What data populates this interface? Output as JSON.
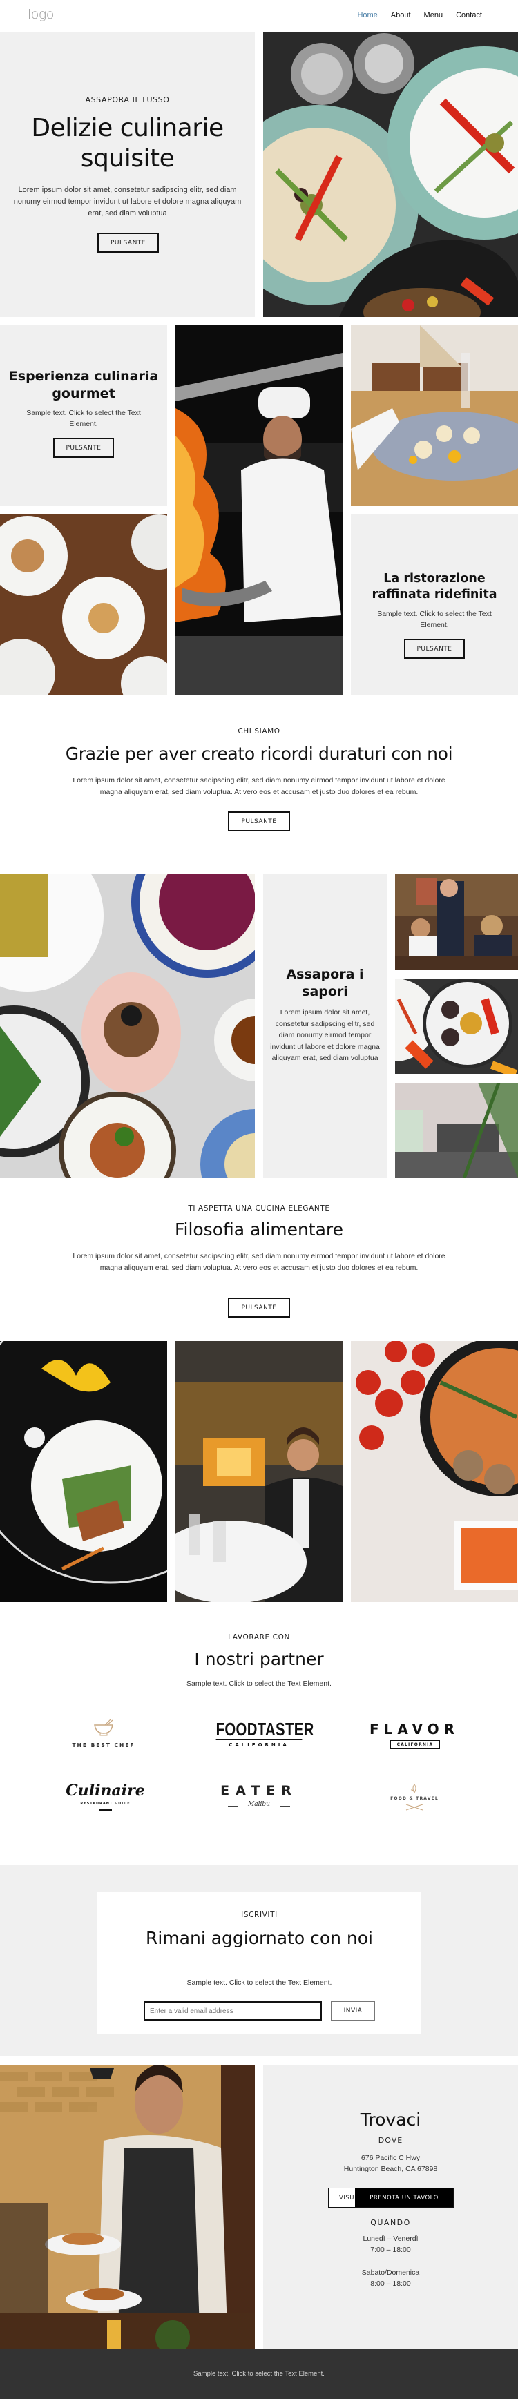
{
  "header": {
    "logo": "logo",
    "nav": [
      {
        "label": "Home",
        "active": true
      },
      {
        "label": "About",
        "active": false
      },
      {
        "label": "Menu",
        "active": false
      },
      {
        "label": "Contact",
        "active": false
      }
    ]
  },
  "hero": {
    "eyebrow": "ASSAPORA IL LUSSO",
    "title": "Delizie culinarie squisite",
    "text": "Lorem ipsum dolor sit amet, consetetur sadipscing elitr, sed diam nonumy eirmod tempor invidunt ut labore et dolore magna aliquyam erat, sed diam voluptua",
    "button": "PULSANTE",
    "image": "mezze-plates-photo"
  },
  "grid": {
    "card1": {
      "title": "Esperienza culinaria gourmet",
      "text": "Sample text. Click to select the Text Element.",
      "button": "PULSANTE"
    },
    "card2": {
      "title": "La ristorazione raffinata ridefinita",
      "text": "Sample text. Click to select the Text Element.",
      "button": "PULSANTE"
    },
    "images": [
      "chef-flambe-photo",
      "scallops-plate-photo",
      "table-dishes-photo"
    ]
  },
  "about": {
    "eyebrow": "CHI SIAMO",
    "title": "Grazie per aver creato ricordi duraturi con noi",
    "text": "Lorem ipsum dolor sit amet, consetetur sadipscing elitr, sed diam nonumy eirmod tempor invidunt ut labore et dolore magna aliquyam erat, sed diam voluptua. At vero eos et accusam et justo duo dolores et ea rebum.",
    "button": "PULSANTE"
  },
  "mosaic": {
    "title": "Assapora i sapori",
    "text": "Lorem ipsum dolor sit amet, consetetur sadipscing elitr, sed diam nonumy eirmod tempor invidunt ut labore et dolore magna aliquyam erat, sed diam voluptua",
    "images": [
      "plated-dishes-marble-photo",
      "friends-dining-photo",
      "vegetables-plate-photo",
      "restaurant-interior-photo"
    ]
  },
  "philosophy": {
    "eyebrow": "TI ASPETTA UNA CUCINA ELEGANTE",
    "title": "Filosofia alimentare",
    "text": "Lorem ipsum dolor sit amet, consetetur sadipscing elitr, sed diam nonumy eirmod tempor invidunt ut labore et dolore magna aliquyam erat, sed diam voluptua. At vero eos et accusam et justo duo dolores et ea rebum.",
    "button": "PULSANTE",
    "images": [
      "duck-salad-plate-photo",
      "man-dining-photo",
      "tomato-meatballs-photo"
    ]
  },
  "partners": {
    "eyebrow": "LAVORARE CON",
    "title": "I nostri partner",
    "text": "Sample text. Click to select the Text Element.",
    "logos": [
      {
        "name": "THE BEST CHEF"
      },
      {
        "name": "FOODTASTER",
        "sub": "CALIFORNIA"
      },
      {
        "name": "FLAVOR",
        "sub": "CALIFORNIA"
      },
      {
        "name": "Culinaire",
        "sub": "RESTAURANT GUIDE"
      },
      {
        "name": "EATER",
        "sub": "Malibu"
      },
      {
        "name": "FOOD & TRAVEL"
      }
    ]
  },
  "newsletter": {
    "eyebrow": "ISCRIVITI",
    "title": "Rimani aggiornato con noi",
    "text": "Sample text. Click to select the Text Element.",
    "email_placeholder": "Enter a valid email address",
    "email_value": "",
    "submit": "INVIA"
  },
  "contact": {
    "title": "Trovaci",
    "where_label": "DOVE",
    "address_line1": "676 Pacific C Hwy",
    "address_line2": "Huntington Beach, CA 67898",
    "visit_button": "VISU",
    "book_button": "PRENOTA UN TAVOLO",
    "when_label": "QUANDO",
    "weekdays": "Lunedì – Venerdì",
    "weekday_hours": "7:00 – 18:00",
    "weekend": "Sabato/Domenica",
    "weekend_hours": "8:00 – 18:00",
    "image": "waiter-serving-photo"
  },
  "footer": {
    "text": "Sample text. Click to select the Text Element."
  }
}
